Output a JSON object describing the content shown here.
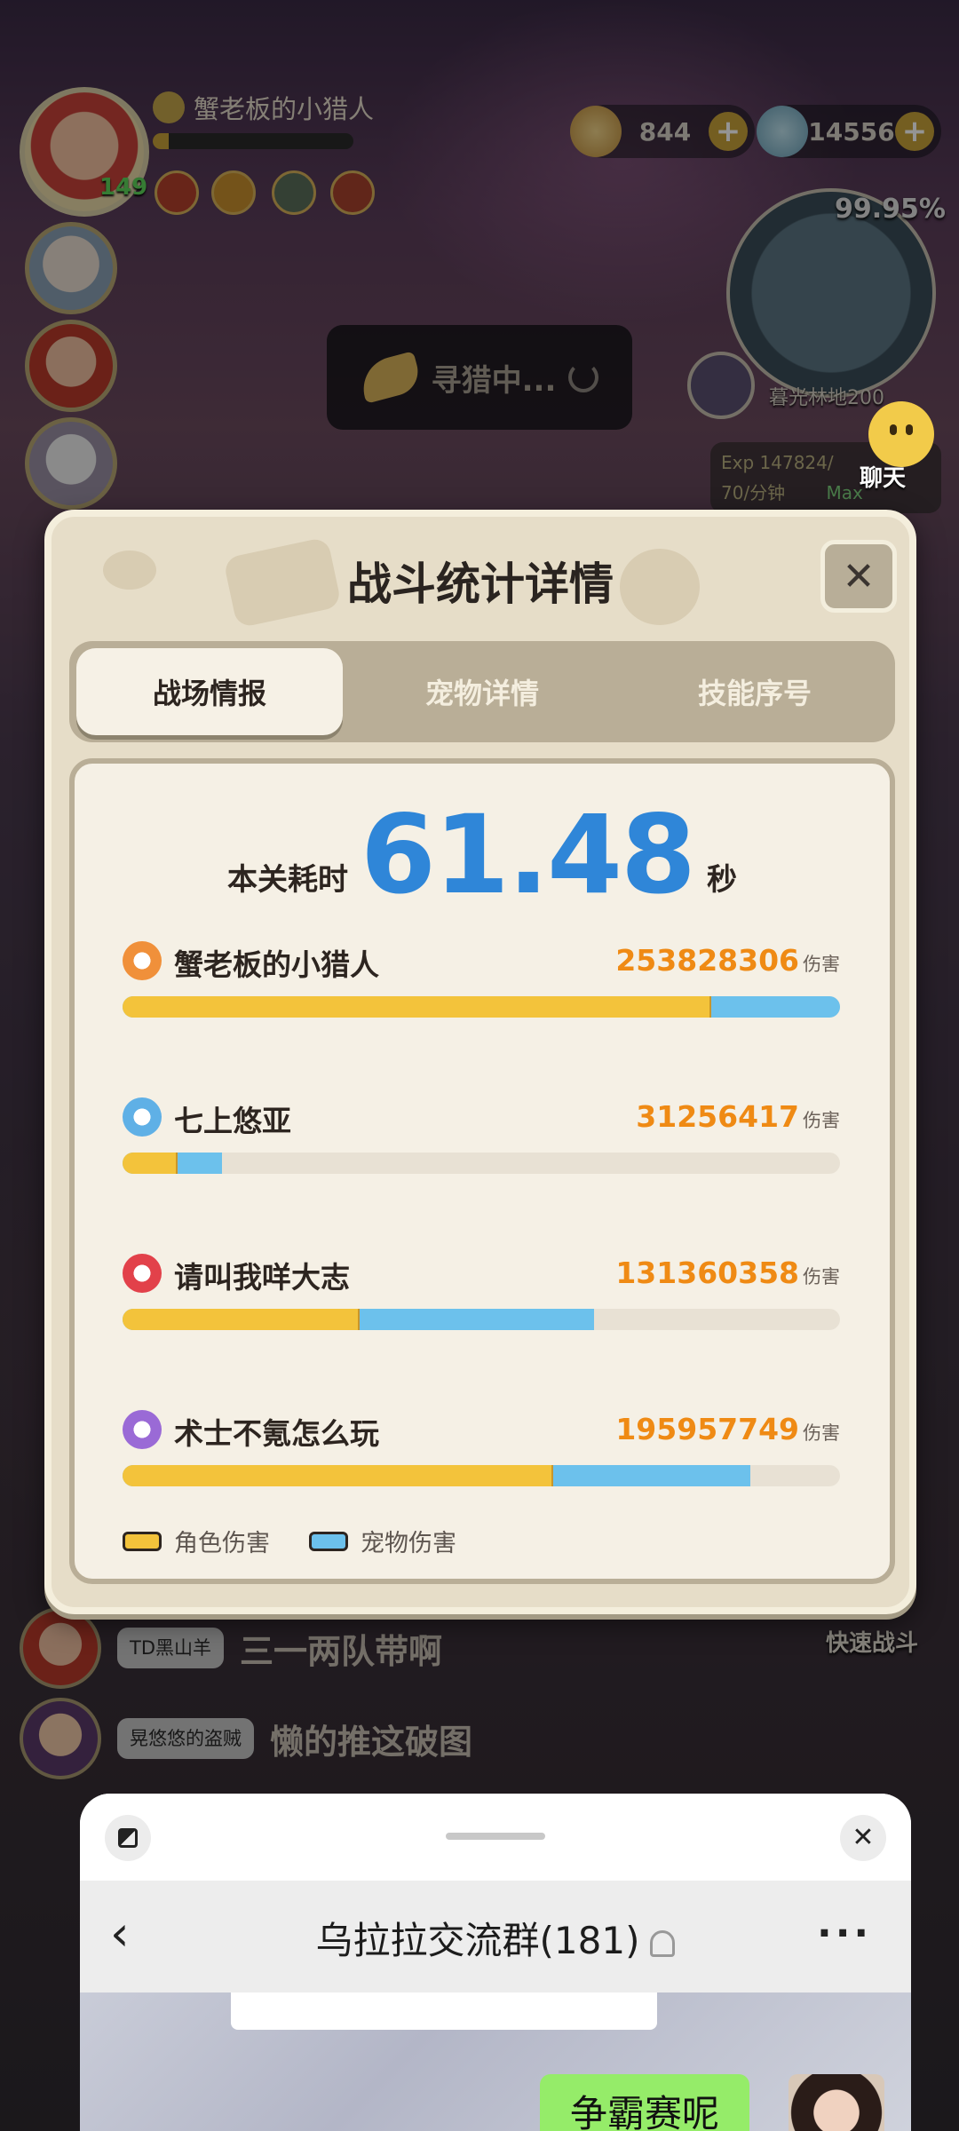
{
  "game": {
    "player_name": "蟹老板的小猎人",
    "level": "149",
    "gold": "844",
    "gems": "14556",
    "map_progress": "99.95%",
    "map_name": "暮光林地200",
    "hunting_status": "寻猎中...",
    "chat_button": "聊天",
    "exp_line": "Exp 147824/",
    "rate_line": "70/分钟",
    "max_tag": "Max",
    "quick_battle": "快速战斗"
  },
  "modal": {
    "title": "战斗统计详情",
    "tabs": [
      {
        "label": "战场情报",
        "active": true
      },
      {
        "label": "宠物详情",
        "active": false
      },
      {
        "label": "技能序号",
        "active": false
      }
    ],
    "time_label": "本关耗时",
    "time_value": "61.48",
    "time_unit": "秒",
    "damage_unit": "伤害",
    "players": [
      {
        "name": "蟹老板的小猎人",
        "damage": "253828306",
        "role_share": 0.82,
        "total_share": 1.0,
        "icon_color": "#f0903a"
      },
      {
        "name": "七上悠亚",
        "damage": "31256417",
        "role_share": 0.077,
        "total_share": 0.138,
        "icon_color": "#5fb0e6"
      },
      {
        "name": "请叫我咩大志",
        "damage": "131360358",
        "role_share": 0.33,
        "total_share": 0.657,
        "icon_color": "#e2414a"
      },
      {
        "name": "术士不氪怎么玩",
        "damage": "195957749",
        "role_share": 0.6,
        "total_share": 0.875,
        "icon_color": "#9a6ad6"
      }
    ],
    "legend_role": "角色伤害",
    "legend_pet": "宠物伤害",
    "colors": {
      "role": "#f3c33b",
      "pet": "#6cc1ec",
      "time": "#2f86d8",
      "damage": "#ef8a14"
    }
  },
  "chat_lines": [
    {
      "tag": "TD黑山羊",
      "text": "三一两队带啊"
    },
    {
      "tag": "晃悠悠的盗贼",
      "text": "懒的推这破图"
    }
  ],
  "wechat": {
    "group_title": "乌拉拉交流群(181)",
    "my_message": "争霸赛呢",
    "icons": {
      "back": "chevron-left-icon",
      "mute": "bell-off-icon",
      "more": "more-dots-icon",
      "close": "close-icon",
      "pip": "minimize-icon"
    }
  }
}
